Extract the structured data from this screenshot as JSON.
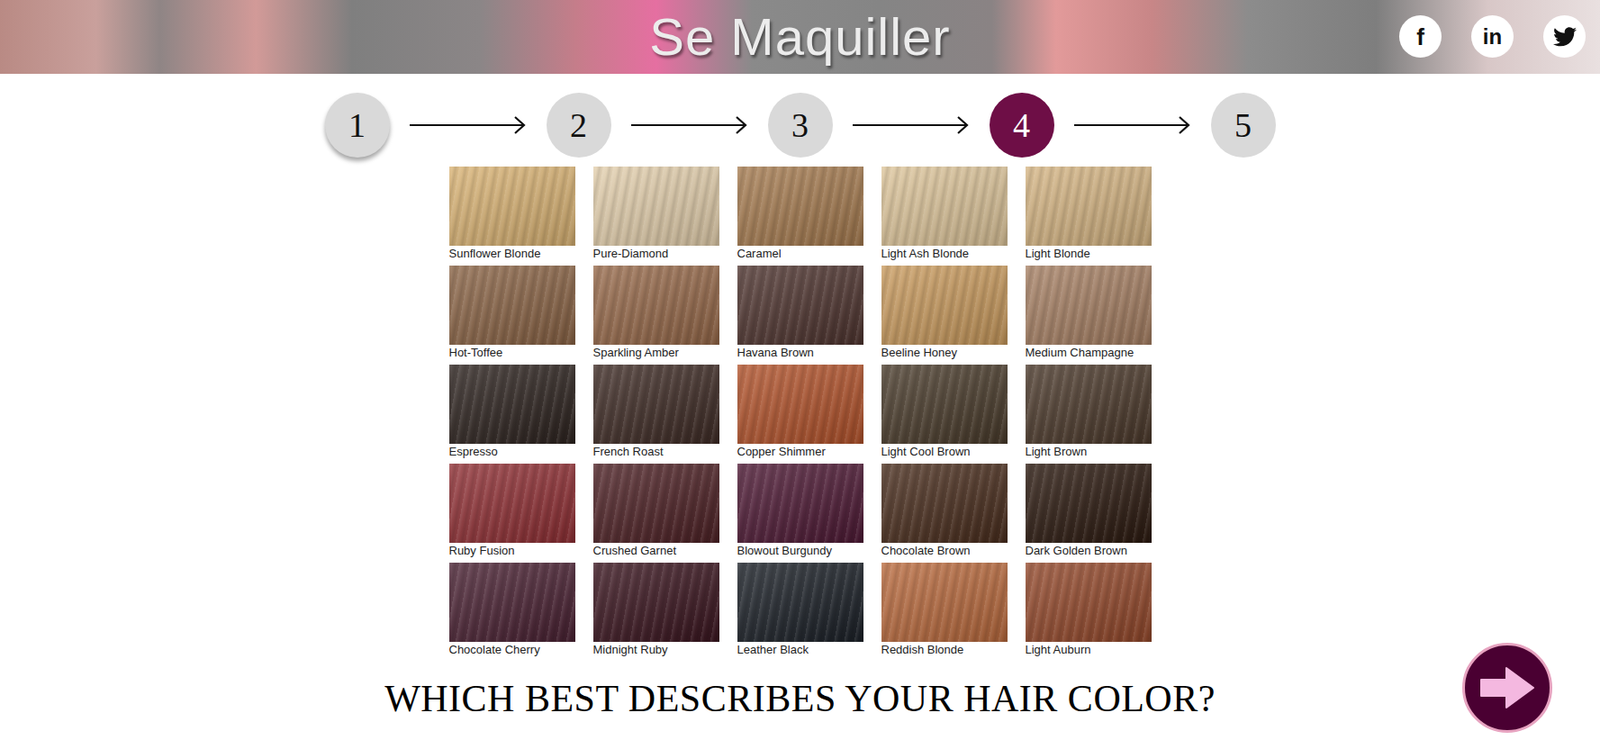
{
  "header": {
    "title": "Se Maquiller",
    "social": [
      {
        "kind": "text",
        "label": "f"
      },
      {
        "kind": "text",
        "label": "in"
      },
      {
        "kind": "bird"
      }
    ]
  },
  "steps": [
    {
      "label": "1",
      "selected": false
    },
    {
      "label": "2",
      "selected": false
    },
    {
      "label": "3",
      "selected": false
    },
    {
      "label": "4",
      "selected": true
    },
    {
      "label": "5",
      "selected": false
    }
  ],
  "swatches": [
    {
      "label": "Sunflower Blonde",
      "color": "#d8b274"
    },
    {
      "label": "Pure-Diamond",
      "color": "#e2ceac"
    },
    {
      "label": "Caramel",
      "color": "#a57b50"
    },
    {
      "label": "Light Ash Blonde",
      "color": "#dcc49a"
    },
    {
      "label": "Light Blonde",
      "color": "#d4b483"
    },
    {
      "label": "Hot-Toffee",
      "color": "#8a6446"
    },
    {
      "label": "Sparkling Amber",
      "color": "#96694a"
    },
    {
      "label": "Havana Brown",
      "color": "#4f3530"
    },
    {
      "label": "Beeline Honey",
      "color": "#c89a5e"
    },
    {
      "label": "Medium Champagne",
      "color": "#a68064"
    },
    {
      "label": "Espresso",
      "color": "#2e2420"
    },
    {
      "label": "French Roast",
      "color": "#3f2c26"
    },
    {
      "label": "Copper Shimmer",
      "color": "#b1532c"
    },
    {
      "label": "Light Cool Brown",
      "color": "#4a3c2c"
    },
    {
      "label": "Light Brown",
      "color": "#4c3a2c"
    },
    {
      "label": "Ruby Fusion",
      "color": "#8f3035"
    },
    {
      "label": "Crushed Garnet",
      "color": "#4e2226"
    },
    {
      "label": "Blowout Burgundy",
      "color": "#4e1a35"
    },
    {
      "label": "Chocolate Brown",
      "color": "#4a2e1e"
    },
    {
      "label": "Dark Golden Brown",
      "color": "#2c1a10"
    },
    {
      "label": "Chocolate Cherry",
      "color": "#4a2233"
    },
    {
      "label": "Midnight Ruby",
      "color": "#3b1620"
    },
    {
      "label": "Leather Black",
      "color": "#1c2128"
    },
    {
      "label": "Reddish Blonde",
      "color": "#b86a3e"
    },
    {
      "label": "Light Auburn",
      "color": "#93492c"
    }
  ],
  "question": "WHICH BEST DESCRIBES YOUR HAIR COLOR?"
}
